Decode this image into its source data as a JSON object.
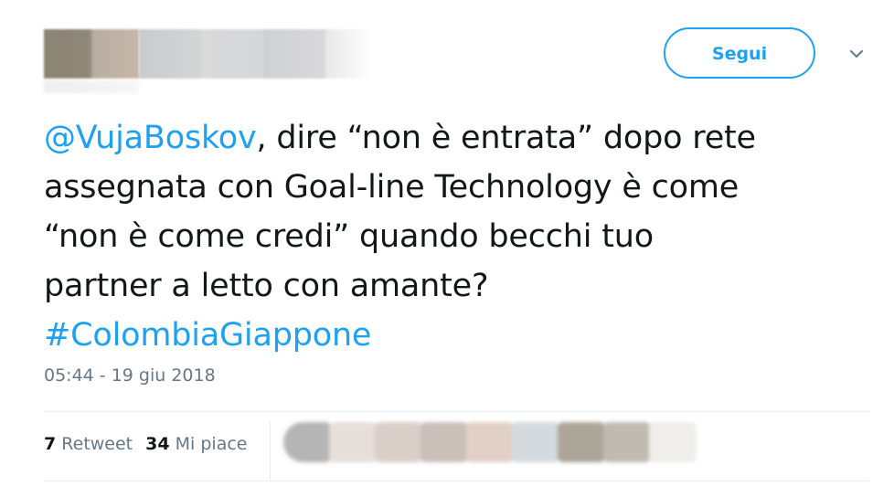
{
  "header": {
    "follow_label": "Segui",
    "icons": {
      "more": "chevron-down-icon"
    }
  },
  "tweet": {
    "mention": "@VujaBoskov",
    "body": ", dire “non è entrata” dopo rete\nassegnata con Goal-line Technology è come\n“non è come credi” quando becchi tuo\npartner a letto con amante?\n",
    "hashtag": "#ColombiaGiappone",
    "timestamp": "05:44 - 19 giu 2018"
  },
  "stats": {
    "retweet_count": "7",
    "retweet_label": "Retweet",
    "like_count": "34",
    "like_label": "Mi piace"
  },
  "colors": {
    "accent": "#1da1f2",
    "text": "#14171a",
    "muted": "#657786",
    "border": "#e6ecf0"
  },
  "likers": [
    {
      "color": "#b5b5b5"
    },
    {
      "color": "#e6ded8"
    },
    {
      "color": "#d8cfc8"
    },
    {
      "color": "#c9bfb9"
    },
    {
      "color": "#e1d0c6"
    },
    {
      "color": "#d5dadf"
    },
    {
      "color": "#aca59a"
    },
    {
      "color": "#bfbab2"
    },
    {
      "color": "#f0eeec"
    }
  ]
}
